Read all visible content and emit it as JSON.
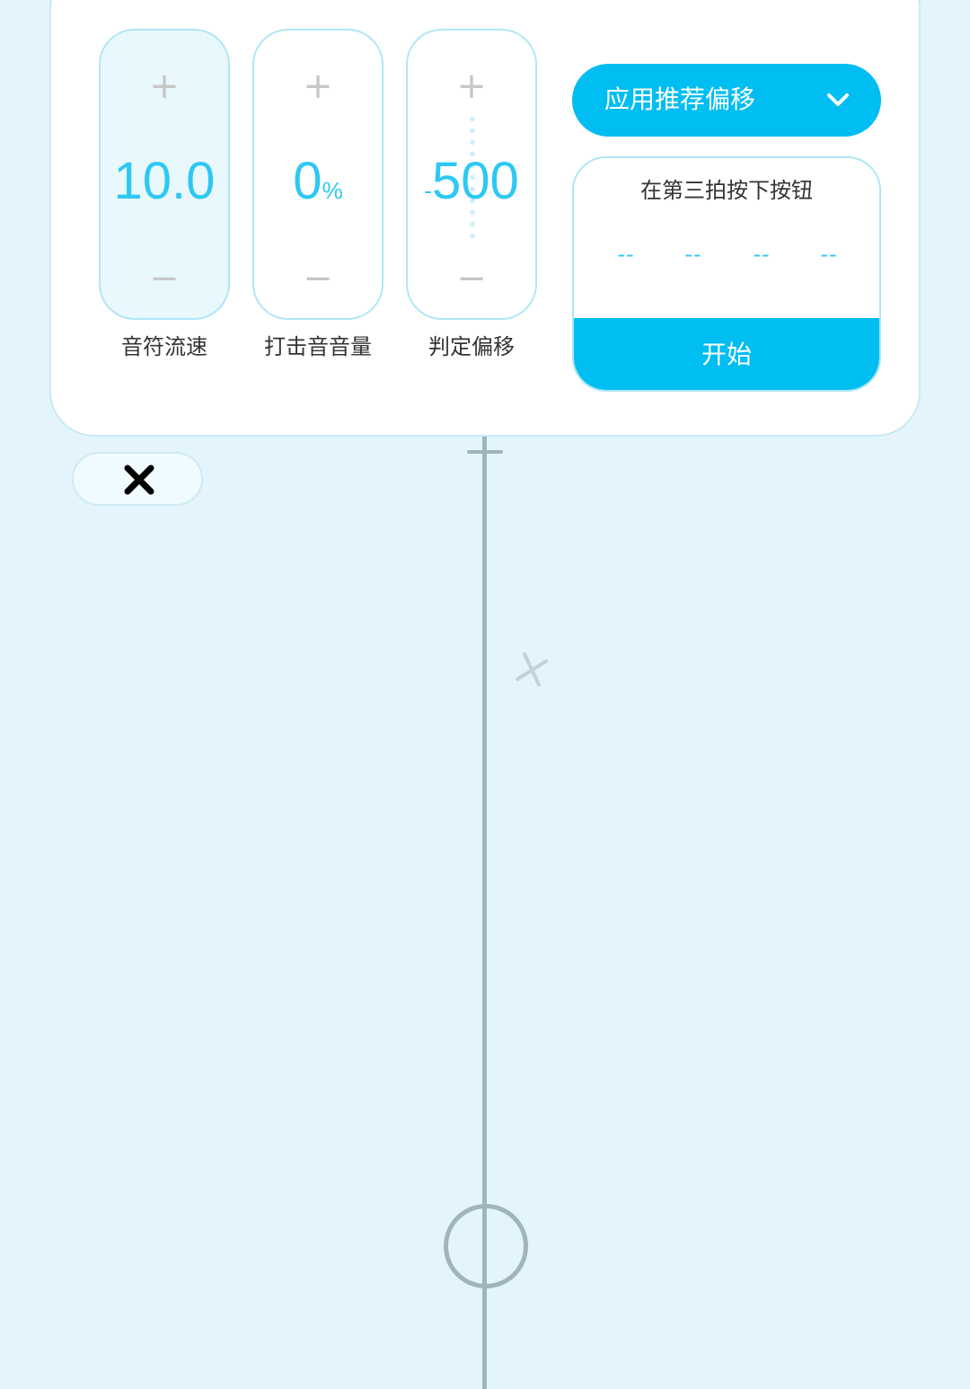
{
  "settings": {
    "knobs": [
      {
        "label": "音符流速",
        "value": "10.0",
        "unit": "",
        "prefix": "",
        "plus": "+",
        "minus": "−"
      },
      {
        "label": "打击音音量",
        "value": "0",
        "unit": "%",
        "prefix": "",
        "plus": "+",
        "minus": "−"
      },
      {
        "label": "判定偏移",
        "value": "500",
        "unit": "",
        "prefix": "-",
        "plus": "+",
        "minus": "−"
      }
    ],
    "apply_button": {
      "label": "应用推荐偏移",
      "icon": "chevron-down-icon"
    },
    "calibration": {
      "instruction": "在第三拍按下按钮",
      "slots": [
        "--",
        "--",
        "--",
        "--"
      ],
      "start_label": "开始"
    }
  },
  "close_button": {
    "icon": "close-icon"
  },
  "colors": {
    "accent": "#00bdf2",
    "value_text": "#2ec8f2",
    "background": "#e3f4fc",
    "track": "#9fb4bb"
  }
}
